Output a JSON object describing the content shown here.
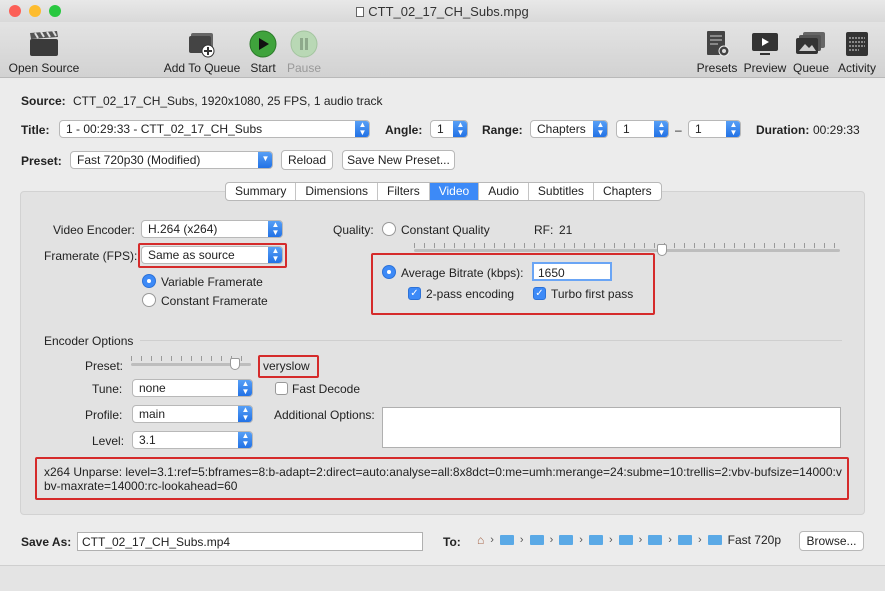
{
  "window": {
    "title": "CTT_02_17_CH_Subs.mpg"
  },
  "toolbar": {
    "open_source": "Open Source",
    "add_to_queue": "Add To Queue",
    "start": "Start",
    "pause": "Pause",
    "presets": "Presets",
    "preview": "Preview",
    "queue": "Queue",
    "activity": "Activity"
  },
  "source": {
    "label": "Source:",
    "value": "CTT_02_17_CH_Subs, 1920x1080, 25 FPS, 1 audio track"
  },
  "title_row": {
    "title_label": "Title:",
    "title_value": "1 - 00:29:33 - CTT_02_17_CH_Subs",
    "angle_label": "Angle:",
    "angle_value": "1",
    "range_label": "Range:",
    "range_value": "Chapters",
    "range_from": "1",
    "range_dash": "–",
    "range_to": "1",
    "duration_label": "Duration:",
    "duration_value": "00:29:33"
  },
  "preset_row": {
    "label": "Preset:",
    "value": "Fast 720p30 (Modified)",
    "reload": "Reload",
    "save_new": "Save New Preset..."
  },
  "tabs": [
    "Summary",
    "Dimensions",
    "Filters",
    "Video",
    "Audio",
    "Subtitles",
    "Chapters"
  ],
  "active_tab": "Video",
  "video": {
    "encoder_label": "Video Encoder:",
    "encoder_value": "H.264 (x264)",
    "framerate_label": "Framerate (FPS):",
    "framerate_value": "Same as source",
    "variable_framerate": "Variable Framerate",
    "constant_framerate": "Constant Framerate",
    "quality_label": "Quality:",
    "constant_quality": "Constant Quality",
    "rf_label": "RF:",
    "rf_value": "21",
    "average_bitrate": "Average Bitrate (kbps):",
    "bitrate_value": "1650",
    "two_pass": "2-pass encoding",
    "turbo": "Turbo first pass"
  },
  "encoder_options": {
    "heading": "Encoder Options",
    "preset_label": "Preset:",
    "preset_value": "veryslow",
    "tune_label": "Tune:",
    "tune_value": "none",
    "fast_decode": "Fast Decode",
    "profile_label": "Profile:",
    "profile_value": "main",
    "additional_label": "Additional Options:",
    "level_label": "Level:",
    "level_value": "3.1"
  },
  "x264_unparse": "x264 Unparse: level=3.1:ref=5:bframes=8:b-adapt=2:direct=auto:analyse=all:8x8dct=0:me=umh:merange=24:subme=10:trellis=2:vbv-bufsize=14000:vbv-maxrate=14000:rc-lookahead=60",
  "save": {
    "label": "Save As:",
    "value": "CTT_02_17_CH_Subs.mp4",
    "to_label": "To:",
    "path_last": "Fast 720p",
    "browse": "Browse..."
  },
  "colors": {
    "accent": "#3d8af7",
    "highlight": "#d52b2b",
    "start_green": "#3fa33c"
  }
}
